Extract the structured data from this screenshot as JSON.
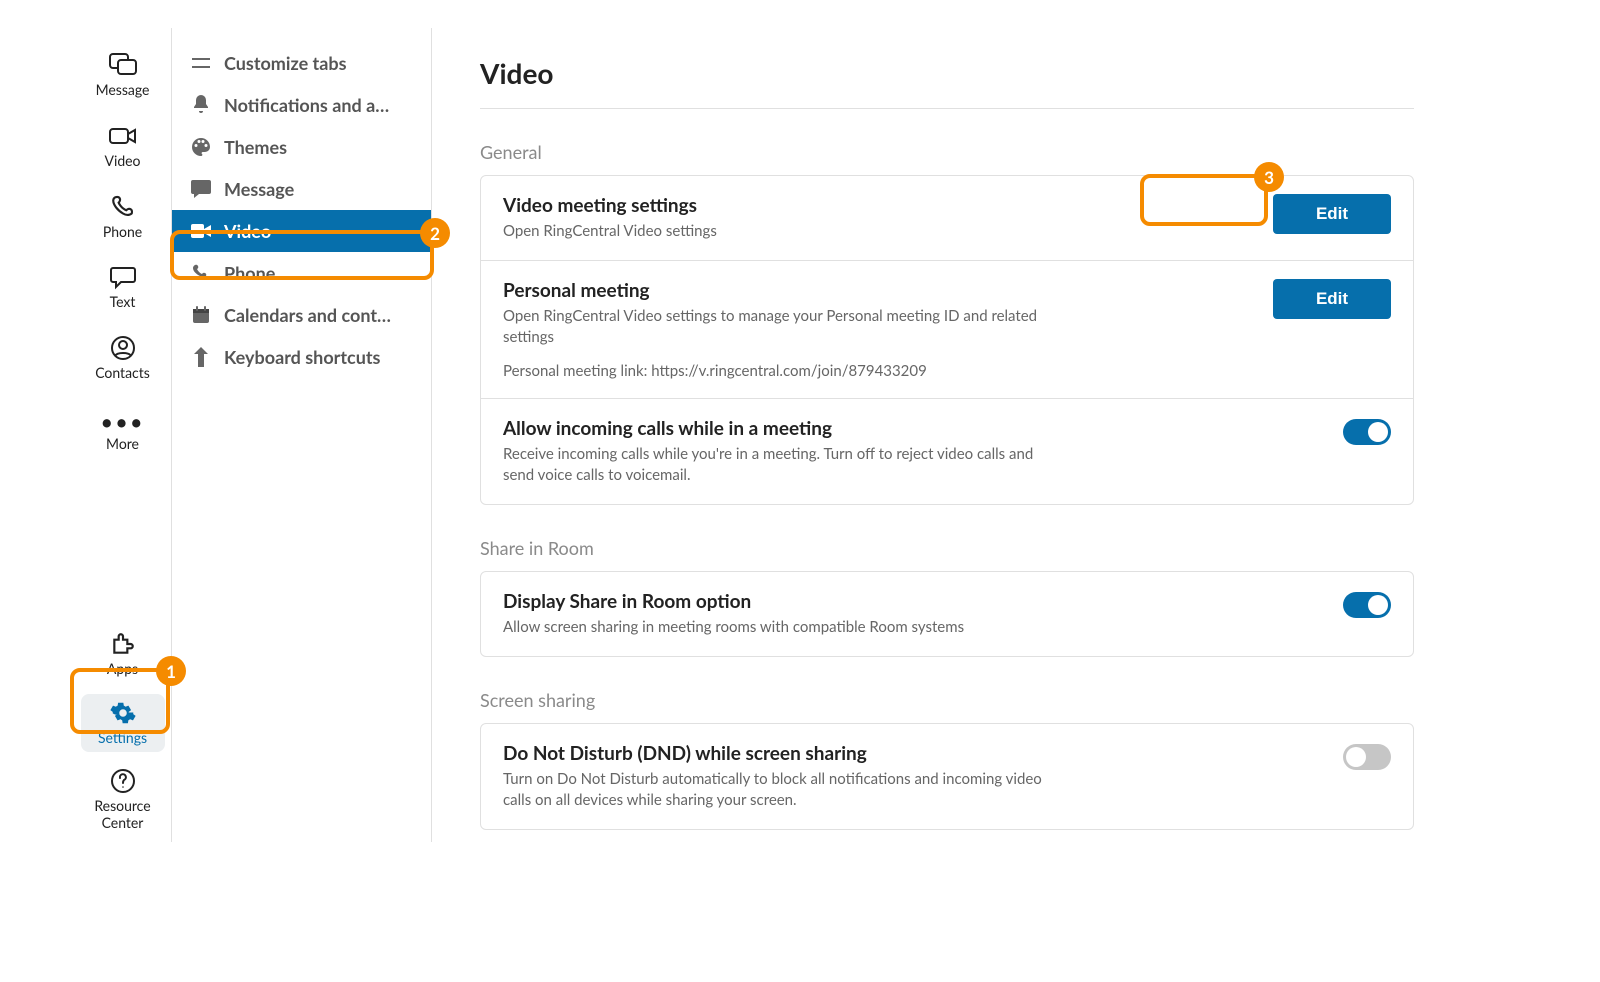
{
  "sidebar": {
    "top": [
      {
        "label": "Message",
        "icon": "message-icon"
      },
      {
        "label": "Video",
        "icon": "video-icon"
      },
      {
        "label": "Phone",
        "icon": "phone-icon"
      },
      {
        "label": "Text",
        "icon": "text-icon"
      },
      {
        "label": "Contacts",
        "icon": "contacts-icon"
      },
      {
        "label": "More",
        "icon": "more-icon"
      }
    ],
    "bottom": [
      {
        "label": "Apps",
        "icon": "puzzle-icon"
      },
      {
        "label": "Settings",
        "icon": "gear-icon",
        "active": true
      },
      {
        "label": "Resource Center",
        "icon": "help-icon"
      }
    ]
  },
  "subnav": {
    "items": [
      {
        "label": "Customize tabs",
        "icon": "customize-icon"
      },
      {
        "label": "Notifications and a…",
        "icon": "bell-icon"
      },
      {
        "label": "Themes",
        "icon": "palette-icon"
      },
      {
        "label": "Message",
        "icon": "message-solid-icon"
      },
      {
        "label": "Video",
        "icon": "video-solid-icon",
        "active": true
      },
      {
        "label": "Phone",
        "icon": "phone-solid-icon"
      },
      {
        "label": "Calendars and cont…",
        "icon": "calendar-icon"
      },
      {
        "label": "Keyboard shortcuts",
        "icon": "keyboard-icon"
      }
    ]
  },
  "page": {
    "title": "Video",
    "sections": [
      {
        "label": "General",
        "rows": [
          {
            "title": "Video meeting settings",
            "desc": "Open RingCentral Video settings",
            "action": {
              "type": "button",
              "label": "Edit"
            }
          },
          {
            "title": "Personal meeting",
            "desc": "Open RingCentral Video settings to manage your Personal meeting ID and related settings",
            "extra": "Personal meeting link: https://v.ringcentral.com/join/879433209",
            "action": {
              "type": "button",
              "label": "Edit"
            }
          },
          {
            "title": "Allow incoming calls while in a meeting",
            "desc": "Receive incoming calls while you're in a meeting. Turn off to reject video calls and send voice calls to voicemail.",
            "action": {
              "type": "toggle",
              "on": true
            }
          }
        ]
      },
      {
        "label": "Share in Room",
        "rows": [
          {
            "title": "Display Share in Room option",
            "desc": "Allow screen sharing in meeting rooms with compatible Room systems",
            "action": {
              "type": "toggle",
              "on": true
            }
          }
        ]
      },
      {
        "label": "Screen sharing",
        "rows": [
          {
            "title": "Do Not Disturb (DND) while screen sharing",
            "desc": "Turn on Do Not Disturb automatically to block all notifications and incoming video calls on all devices while sharing your screen.",
            "action": {
              "type": "toggle",
              "on": false
            }
          }
        ]
      }
    ]
  },
  "annotations": [
    {
      "number": "1",
      "target": "settings-nav"
    },
    {
      "number": "2",
      "target": "subnav-video"
    },
    {
      "number": "3",
      "target": "edit-video-meeting"
    }
  ]
}
